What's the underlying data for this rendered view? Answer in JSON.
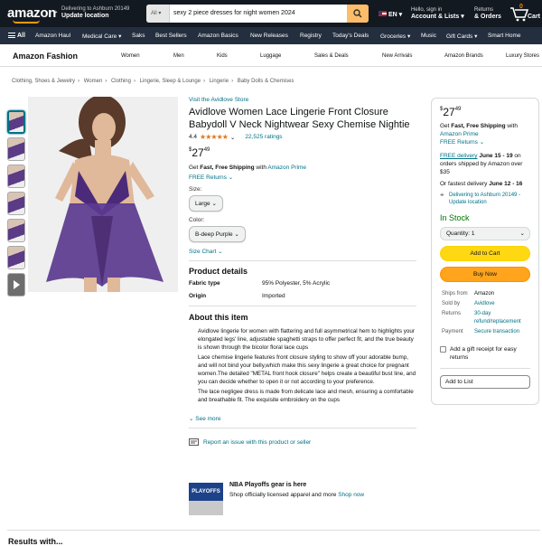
{
  "header": {
    "logo": "amazon",
    "deliver_line1": "Delivering to Ashburn 20149",
    "deliver_line2": "Update location",
    "search_category": "All",
    "search_query": "sexy 2 piece dresses for night women 2024",
    "lang": "EN",
    "account_line1": "Hello, sign in",
    "account_line2": "Account & Lists",
    "orders_line1": "Returns",
    "orders_line2": "& Orders",
    "cart_count": "0",
    "cart_label": "Cart"
  },
  "nav": {
    "all": "All",
    "items": [
      "Amazon Haul",
      "Medical Care",
      "Saks",
      "Best Sellers",
      "Amazon Basics",
      "New Releases",
      "Registry",
      "Today's Deals",
      "Groceries",
      "Music",
      "Gift Cards",
      "Smart Home"
    ]
  },
  "subnav": {
    "title": "Amazon Fashion",
    "items": [
      "Women",
      "Men",
      "Kids",
      "Luggage",
      "Sales & Deals",
      "New Arrivals",
      "Amazon Brands",
      "Luxury Stores"
    ]
  },
  "breadcrumb": [
    "Clothing, Shoes & Jewelry",
    "Women",
    "Clothing",
    "Lingerie, Sleep & Lounge",
    "Lingerie",
    "Baby Dolls & Chemises"
  ],
  "product": {
    "store": "Visit the Avidlove Store",
    "title": "Avidlove Women Lace Lingerie Front Closure Babydoll V Neck Nightwear Sexy Chemise Nightie",
    "rating": "4.4",
    "ratings_count": "22,525 ratings",
    "price_symbol": "$",
    "price_whole": "27",
    "price_frac": "49",
    "ship_pre": "Get ",
    "ship_bold": "Fast, Free Shipping",
    "ship_mid": " with ",
    "ship_link": "Amazon Prime",
    "returns": "FREE Returns",
    "size_label": "Size:",
    "size_value": "Large",
    "color_label": "Color:",
    "color_value": "B-deep Purple",
    "size_chart": "Size Chart"
  },
  "details": {
    "heading": "Product details",
    "rows": [
      {
        "k": "Fabric type",
        "v": "95% Polyester, 5% Acrylic"
      },
      {
        "k": "Origin",
        "v": "Imported"
      }
    ]
  },
  "about": {
    "heading": "About this item",
    "bullets": [
      "Avidlove lingerie for women with flattering and full asymmetrical hem to highlights your elongated legs' line, adjustable spaghetti straps to offer perfect fit, and the true beauty is shown through the bicolor floral lace cups",
      "Lace chemise lingerie features front closure styling to show off your adorable bump, and will not bind your belly,which make this sexy lingerie a great choice for pregnant women.The detailed \"METAL front hook closure\" helps create a beautiful bust line, and you can decide whether to open it or not according to your preference.",
      "The lace negligee dress is made from delicate lace and mesh, ensuring a comfortable and breathable fit. The exquisite embroidery on the cups"
    ],
    "see_more": "See more",
    "report": "Report an issue with this product or seller"
  },
  "promo": {
    "image_text": "PLAYOFFS",
    "title": "NBA Playoffs gear is here",
    "sub": "Shop officially licensed apparel and more",
    "link": "Shop now"
  },
  "buybox": {
    "price_symbol": "$",
    "price_whole": "27",
    "price_frac": "49",
    "ship_pre": "Get ",
    "ship_bold": "Fast, Free Shipping",
    "ship_mid": " with",
    "ship_link": "Amazon Prime",
    "returns": "FREE Returns",
    "delivery_link": "FREE delivery",
    "delivery_date": "June 15 - 19",
    "delivery_rest": "on orders shipped by Amazon over $35",
    "fast_pre": "Or fastest delivery",
    "fast_date": "June 12 - 16",
    "location": "Delivering to Ashburn 20149 - Update location",
    "stock": "In Stock",
    "qty": "Quantity: 1",
    "add_to_cart": "Add to Cart",
    "buy_now": "Buy Now",
    "table": [
      {
        "k": "Ships from",
        "v": "Amazon",
        "link": false
      },
      {
        "k": "Sold by",
        "v": "Avidlove",
        "link": true
      },
      {
        "k": "Returns",
        "v": "30-day refund/replacement",
        "link": true
      },
      {
        "k": "Payment",
        "v": "Secure transaction",
        "link": true
      }
    ],
    "gift": "Add a gift receipt for easy returns",
    "add_to_list": "Add to List"
  },
  "bottom_heading": "Results with..."
}
